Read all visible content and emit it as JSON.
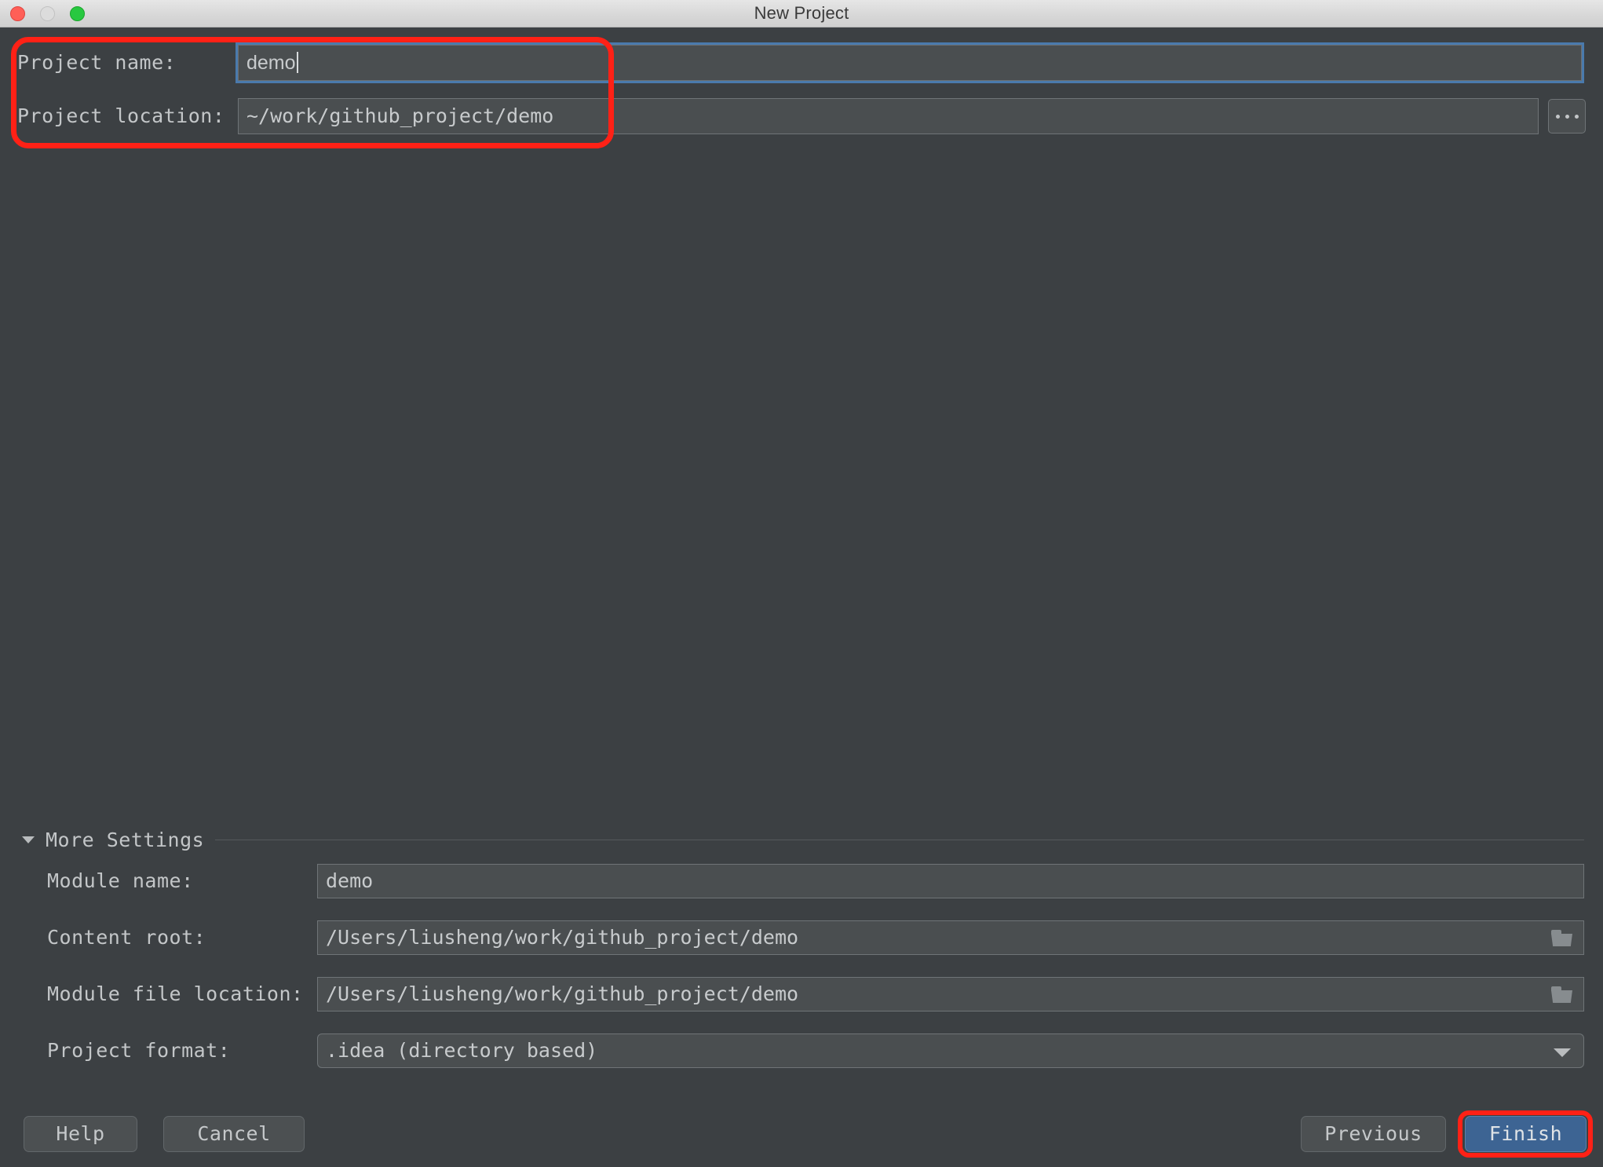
{
  "window": {
    "title": "New Project",
    "traffic_lights": [
      "close-button",
      "minimize-button",
      "zoom-button"
    ]
  },
  "form": {
    "project_name": {
      "label": "Project name:",
      "value": "demo"
    },
    "project_location": {
      "label": "Project location:",
      "value": "~/work/github_project/demo",
      "browse_label": "..."
    }
  },
  "more_settings": {
    "label": "More Settings",
    "expanded": true,
    "rows": [
      {
        "label": "Module name:",
        "value": "demo",
        "control": "text"
      },
      {
        "label": "Content root:",
        "value": "/Users/liusheng/work/github_project/demo",
        "control": "folder"
      },
      {
        "label": "Module file location:",
        "value": "/Users/liusheng/work/github_project/demo",
        "control": "folder"
      },
      {
        "label": "Project format:",
        "value": ".idea (directory based)",
        "control": "combo"
      }
    ]
  },
  "footer": {
    "help": "Help",
    "cancel": "Cancel",
    "previous": "Previous",
    "finish": "Finish"
  },
  "colors": {
    "background": "#3c4043",
    "field_bg": "#4a4e50",
    "accent_blue": "#3d6493",
    "focus_ring": "#4a7aad",
    "annotation_red": "#ff2116",
    "text": "#c3c6c8"
  }
}
